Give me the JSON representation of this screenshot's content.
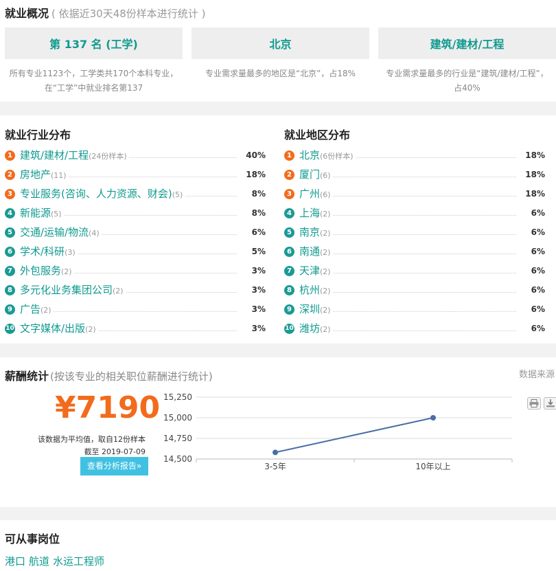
{
  "overview": {
    "title": "就业概况",
    "subtitle": "( 依据近30天48份样本进行统计 )",
    "cards": [
      {
        "value": "第 137 名 (工学)",
        "desc": "所有专业1123个，工学类共170个本科专业，在“工学”中就业排名第137"
      },
      {
        "value": "北京",
        "desc": "专业需求量最多的地区是“北京”，占18%"
      },
      {
        "value": "建筑/建材/工程",
        "desc": "专业需求量最多的行业是“建筑/建材/工程”，占40%"
      }
    ]
  },
  "industry": {
    "title": "就业行业分布",
    "items": [
      {
        "rank": "1",
        "name": "建筑/建材/工程",
        "count": "(24份样本)",
        "pct": "40%"
      },
      {
        "rank": "2",
        "name": "房地产",
        "count": "(11)",
        "pct": "18%"
      },
      {
        "rank": "3",
        "name": "专业服务(咨询、人力资源、财会)",
        "count": "(5)",
        "pct": "8%"
      },
      {
        "rank": "4",
        "name": "新能源",
        "count": "(5)",
        "pct": "8%"
      },
      {
        "rank": "5",
        "name": "交通/运输/物流",
        "count": "(4)",
        "pct": "6%"
      },
      {
        "rank": "6",
        "name": "学术/科研",
        "count": "(3)",
        "pct": "5%"
      },
      {
        "rank": "7",
        "name": "外包服务",
        "count": "(2)",
        "pct": "3%"
      },
      {
        "rank": "8",
        "name": "多元化业务集团公司",
        "count": "(2)",
        "pct": "3%"
      },
      {
        "rank": "9",
        "name": "广告",
        "count": "(2)",
        "pct": "3%"
      },
      {
        "rank": "10",
        "name": "文字媒体/出版",
        "count": "(2)",
        "pct": "3%"
      }
    ]
  },
  "region": {
    "title": "就业地区分布",
    "items": [
      {
        "rank": "1",
        "name": "北京",
        "count": "(6份样本)",
        "pct": "18%"
      },
      {
        "rank": "2",
        "name": "厦门",
        "count": "(6)",
        "pct": "18%"
      },
      {
        "rank": "3",
        "name": "广州",
        "count": "(6)",
        "pct": "18%"
      },
      {
        "rank": "4",
        "name": "上海",
        "count": "(2)",
        "pct": "6%"
      },
      {
        "rank": "5",
        "name": "南京",
        "count": "(2)",
        "pct": "6%"
      },
      {
        "rank": "6",
        "name": "南通",
        "count": "(2)",
        "pct": "6%"
      },
      {
        "rank": "7",
        "name": "天津",
        "count": "(2)",
        "pct": "6%"
      },
      {
        "rank": "8",
        "name": "杭州",
        "count": "(2)",
        "pct": "6%"
      },
      {
        "rank": "9",
        "name": "深圳",
        "count": "(2)",
        "pct": "6%"
      },
      {
        "rank": "10",
        "name": "潍坊",
        "count": "(2)",
        "pct": "6%"
      }
    ]
  },
  "salary": {
    "title": "薪酬统计",
    "subtitle": "(按该专业的相关职位薪酬进行统计)",
    "source": "数据来源",
    "amount": "¥7190",
    "avg_note": "该数据为平均值，取自12份样本",
    "as_of": "截至 2019-07-09",
    "report_button": "查看分析报告»",
    "print_icon": "printer-icon",
    "download_icon": "download-icon"
  },
  "chart_data": {
    "type": "line",
    "categories": [
      "3-5年",
      "10年以上"
    ],
    "series": [
      {
        "values": [
          14580,
          15000
        ]
      }
    ],
    "yticks": [
      "15,250",
      "15,000",
      "14,750",
      "14,500"
    ],
    "ylim": [
      14500,
      15250
    ],
    "grid": true,
    "line_color": "#4a6fa5"
  },
  "jobs": {
    "title": "可从事岗位",
    "items": [
      "港口",
      "航道",
      "水运工程师"
    ]
  },
  "colors": {
    "accent": "#0f9a8f",
    "orange": "#f26b1d",
    "teal": "#1a9a93",
    "button": "#41c1e2"
  }
}
